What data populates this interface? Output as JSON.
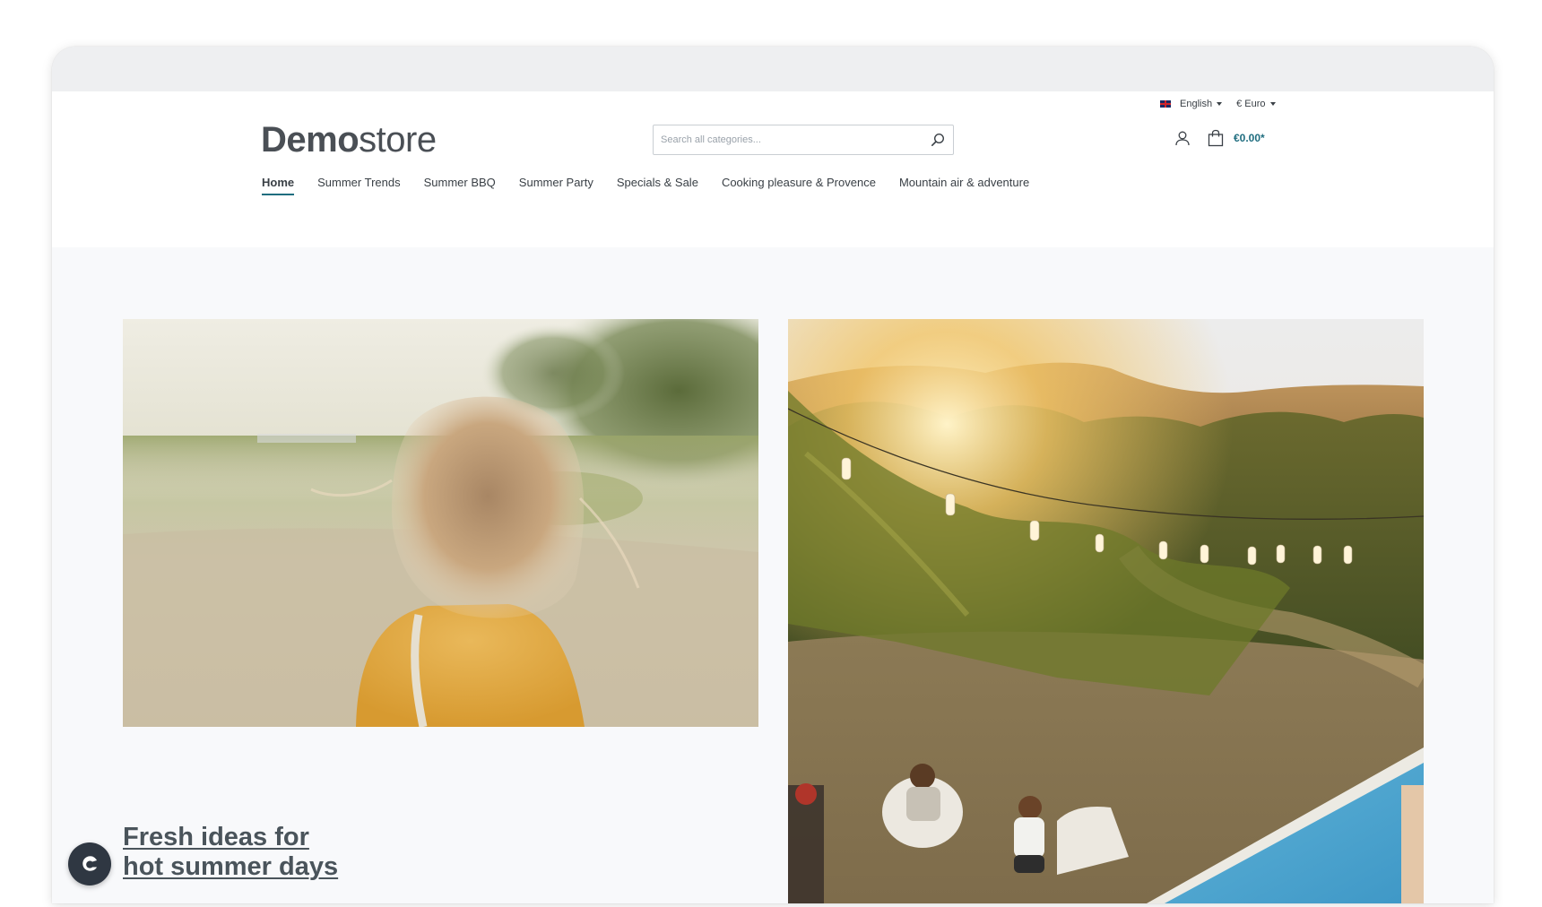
{
  "topbar": {
    "language_label": "English",
    "currency_label": "€ Euro"
  },
  "logo": {
    "bold_part": "Demo",
    "light_part": "store"
  },
  "search": {
    "placeholder": "Search all categories..."
  },
  "cart": {
    "total": "€0.00*"
  },
  "nav": {
    "items": [
      {
        "label": "Home",
        "active": true
      },
      {
        "label": "Summer Trends"
      },
      {
        "label": "Summer BBQ"
      },
      {
        "label": "Summer Party"
      },
      {
        "label": "Specials & Sale"
      },
      {
        "label": "Cooking pleasure & Provence"
      },
      {
        "label": "Mountain air & adventure"
      }
    ]
  },
  "hero": {
    "headline_line1": "Fresh ideas for",
    "headline_line2": "hot summer days",
    "left_image_alt": "girl-in-field-photo",
    "right_image_alt": "pool-party-photo"
  },
  "icons": {
    "search": "search-icon",
    "account": "user-icon",
    "cart": "shopping-bag-icon",
    "chat": "chat-icon"
  },
  "colors": {
    "accent": "#1f6d7f",
    "text": "#4a545b",
    "content_bg": "#f8f9fb"
  }
}
